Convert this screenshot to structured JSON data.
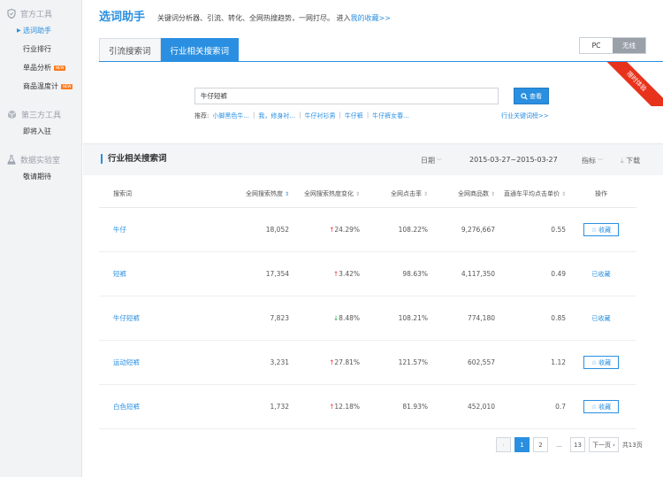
{
  "sidebar": {
    "groups": [
      {
        "title": "官方工具",
        "items": [
          {
            "label": "选词助手",
            "active": true,
            "badge": ""
          },
          {
            "label": "行业排行",
            "active": false,
            "badge": ""
          },
          {
            "label": "单品分析",
            "active": false,
            "badge": "NEW"
          },
          {
            "label": "商品温度计",
            "active": false,
            "badge": "NEW"
          }
        ]
      },
      {
        "title": "第三方工具",
        "items": [
          {
            "label": "即将入驻",
            "active": false,
            "badge": ""
          }
        ]
      },
      {
        "title": "数据实验室",
        "items": [
          {
            "label": "敬请期待",
            "active": false,
            "badge": ""
          }
        ]
      }
    ]
  },
  "header": {
    "brand": "选词助手",
    "slogan": "关键词分析器、引流、转化、全网热搜趋势，一网打尽。 进入",
    "slogan_link": "我的收藏>>"
  },
  "tabs": [
    "引流搜索词",
    "行业相关搜索词"
  ],
  "device": {
    "pc": "PC",
    "wireless": "无线"
  },
  "ribbon": "限时体验",
  "search": {
    "value": "牛仔短裤",
    "button": "查看",
    "recommend_label": "推荐:",
    "recommend": [
      "小脚黑色牛...",
      "我，修身衬...",
      "牛仔衬衫男",
      "牛仔裤",
      "牛仔裤女春..."
    ],
    "kw_list": "行业关键词榜>>"
  },
  "section": {
    "title": "行业相关搜索词",
    "date_label": "日期",
    "date_range": "2015-03-27~2015-03-27",
    "metric_label": "指标",
    "download": "下载"
  },
  "table": {
    "columns": [
      "搜索词",
      "全网搜索热度",
      "全网搜索热度变化",
      "全网点击率",
      "全网商品数",
      "直通车平均点击单价",
      "操作"
    ],
    "rows": [
      {
        "kw": "牛仔",
        "heat": "18,052",
        "change": "24.29%",
        "dir": "up",
        "ctr": "108.22%",
        "goods": "9,276,667",
        "cpc": "0.55",
        "action": "收藏",
        "faved": false
      },
      {
        "kw": "短裤",
        "heat": "17,354",
        "change": "3.42%",
        "dir": "up",
        "ctr": "98.63%",
        "goods": "4,117,350",
        "cpc": "0.49",
        "action": "已收藏",
        "faved": true
      },
      {
        "kw": "牛仔短裤",
        "heat": "7,823",
        "change": "8.48%",
        "dir": "down",
        "ctr": "108.21%",
        "goods": "774,180",
        "cpc": "0.85",
        "action": "已收藏",
        "faved": true
      },
      {
        "kw": "运动短裤",
        "heat": "3,231",
        "change": "27.81%",
        "dir": "up",
        "ctr": "121.57%",
        "goods": "602,557",
        "cpc": "1.12",
        "action": "收藏",
        "faved": false
      },
      {
        "kw": "白色短裤",
        "heat": "1,732",
        "change": "12.18%",
        "dir": "up",
        "ctr": "81.93%",
        "goods": "452,010",
        "cpc": "0.7",
        "action": "收藏",
        "faved": false
      }
    ]
  },
  "pager": {
    "pages": [
      "1",
      "2",
      "...",
      "13"
    ],
    "next": "下一页",
    "total": "共13页"
  },
  "colors": {
    "accent": "#2a8fe0",
    "up": "#e33333",
    "down": "#2bb24c",
    "ribbon": "#e8331c"
  }
}
